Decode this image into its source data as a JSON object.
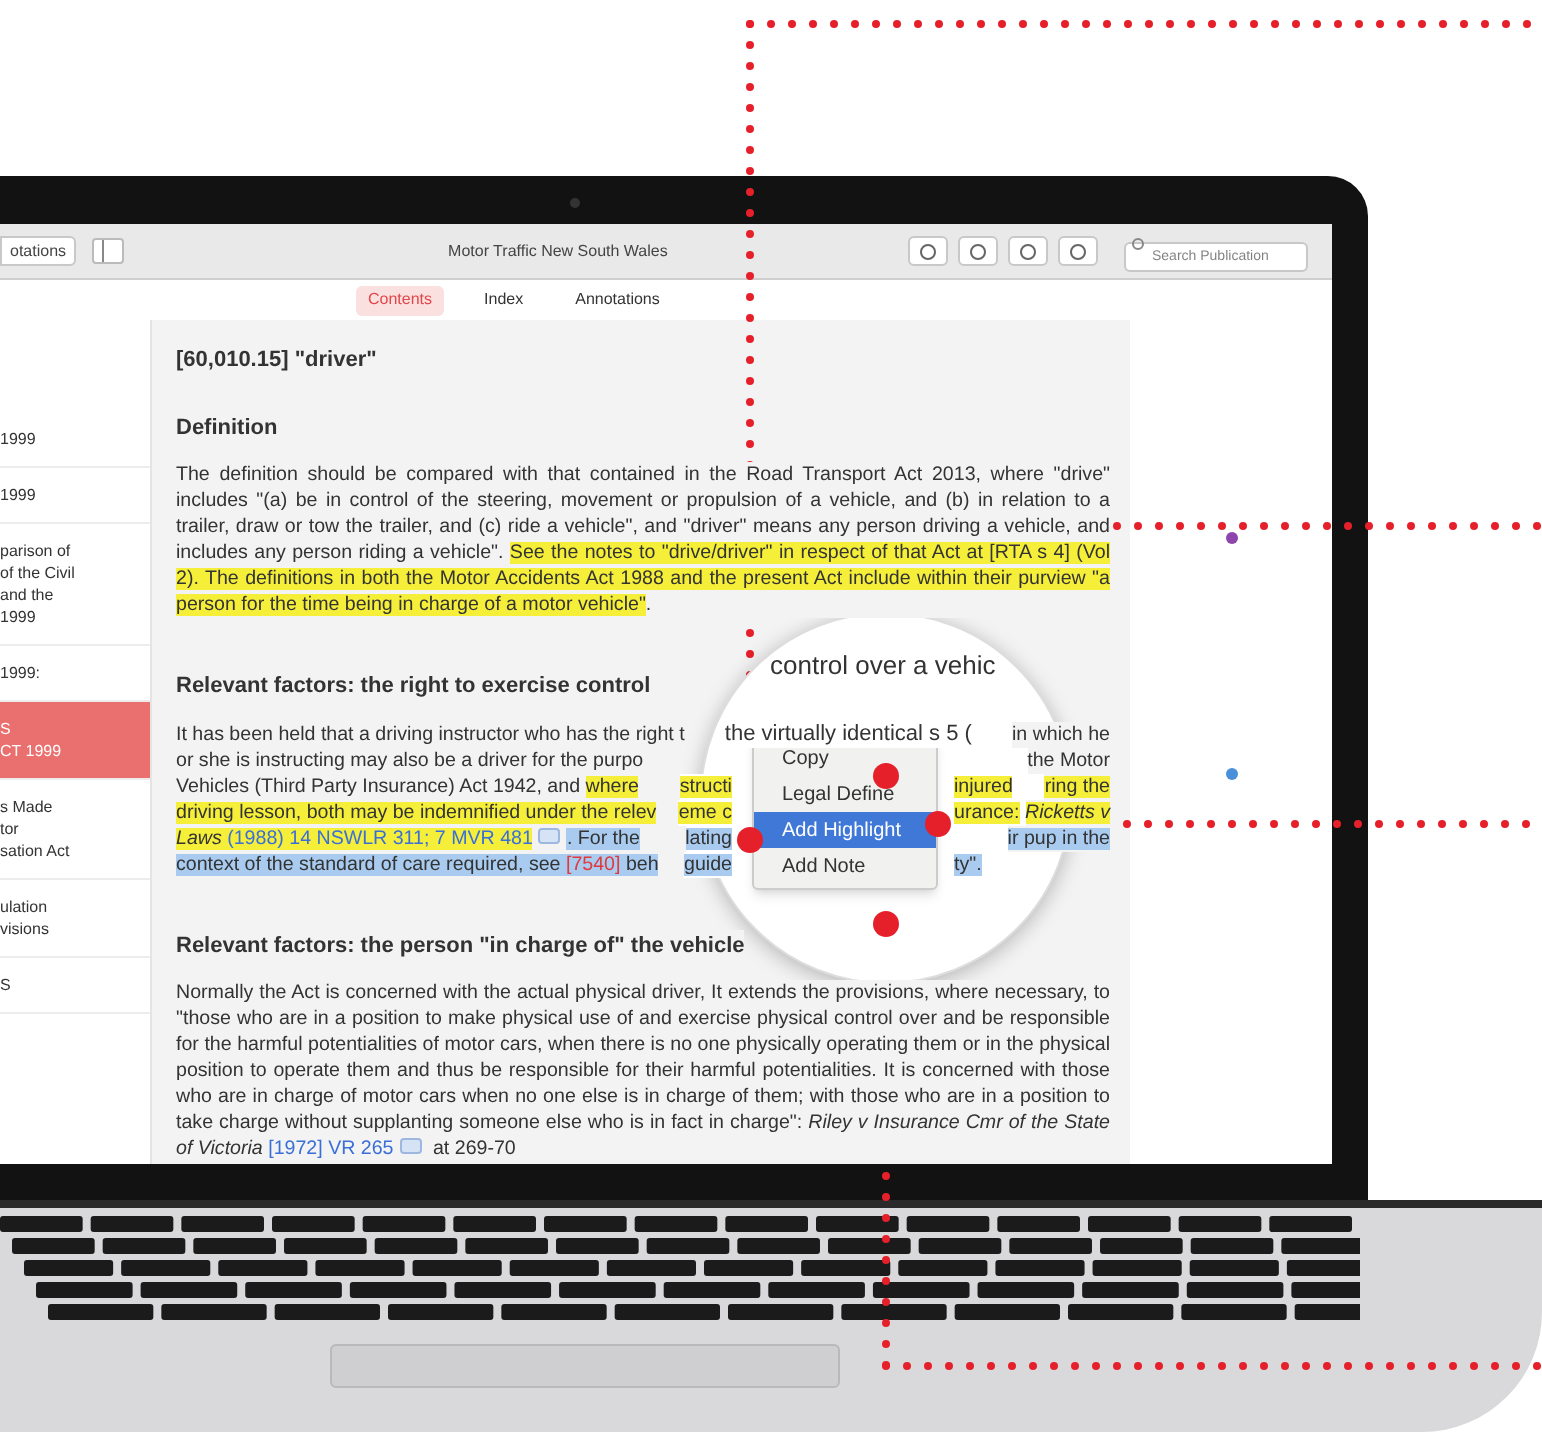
{
  "toolbar": {
    "annotations_button": "otations",
    "title": "Motor Traffic New South Wales",
    "search": {
      "placeholder": "Search Publication"
    }
  },
  "tabs": [
    {
      "label": "Contents",
      "selected": true
    },
    {
      "label": "Index",
      "selected": false
    },
    {
      "label": "Annotations",
      "selected": false
    }
  ],
  "sidebar": {
    "items": [
      {
        "lines": [
          "1999"
        ],
        "selected": false
      },
      {
        "lines": [
          "1999"
        ],
        "selected": false
      },
      {
        "lines": [
          "parison of",
          "of the Civil",
          "and the",
          "1999"
        ],
        "selected": false
      },
      {
        "lines": [
          "1999:"
        ],
        "selected": false
      },
      {
        "lines": [
          "S",
          "CT 1999"
        ],
        "selected": true
      },
      {
        "lines": [
          "s Made",
          "tor",
          "sation Act"
        ],
        "selected": false
      },
      {
        "lines": [
          "ulation",
          "visions"
        ],
        "selected": false
      },
      {
        "lines": [
          "S"
        ],
        "selected": false
      }
    ]
  },
  "document": {
    "title": "[60,010.15] \"driver\"",
    "sections": [
      {
        "heading": "Definition",
        "kind": "flow",
        "segments": [
          {
            "kind": "plain",
            "text": "The definition should be compared with that contained in the Road Transport Act 2013, where \"drive\" includes \"(a) be in control of the steering, movement or propulsion of a vehicle, and (b) in relation to a trailer, draw or tow the trailer, and (c) ride a vehicle\", and \"driver\" means any person driving a vehicle, and includes any person riding a vehicle\". "
          },
          {
            "kind": "highlight",
            "text": "See the notes to \"drive/driver\" in respect of that Act at [RTA s 4] (Vol 2). The definitions in both the Motor Accidents Act 1988 and the present Act include within their purview \"a person for the time being in charge of a motor vehicle\""
          },
          {
            "kind": "plain",
            "text": "."
          }
        ]
      },
      {
        "heading": "Relevant factors: the right to exercise control",
        "kind": "lens_rows",
        "rows": [
          {
            "left": [
              {
                "kind": "plain",
                "text": "It has been held that a driving instructor who has the right t"
              }
            ],
            "lens": [
              {
                "kind": "plain",
                "text": "the virtually identical s 5 ("
              }
            ],
            "right": [
              {
                "kind": "plain",
                "text": "in which he"
              }
            ]
          },
          {
            "left": [
              {
                "kind": "plain",
                "text": "or she is instructing may also be a driver for the purpo"
              }
            ],
            "right": [
              {
                "kind": "plain",
                "text": "the Motor"
              }
            ]
          },
          {
            "left": [
              {
                "kind": "plain",
                "text": "Vehicles (Third Party Insurance) Act 1942, and "
              },
              {
                "kind": "highlight",
                "text": "where"
              }
            ],
            "lens_left": [
              {
                "kind": "highlight",
                "text": "structi"
              }
            ],
            "lens_right": [
              {
                "kind": "highlight",
                "text": "injured"
              }
            ],
            "right": [
              {
                "kind": "highlight",
                "text": "ring the"
              }
            ]
          },
          {
            "left": [
              {
                "kind": "highlight",
                "text": "driving lesson, both may be indemnified under the relev"
              }
            ],
            "lens_left": [
              {
                "kind": "highlight",
                "text": "eme c"
              }
            ],
            "lens_right": [
              {
                "kind": "highlight",
                "text": "urance:"
              }
            ],
            "right": [
              {
                "kind": "highlight_italic",
                "text": "Ricketts v"
              }
            ]
          },
          {
            "left": [
              {
                "kind": "highlight_italic",
                "text": "Laws "
              },
              {
                "kind": "highlight_link",
                "text": "(1988) 14 NSWLR 311; 7 MVR 481"
              },
              {
                "kind": "link_icon"
              },
              {
                "kind": "selected",
                "text": ". For the"
              }
            ],
            "lens_left": [
              {
                "kind": "selected",
                "text": "lating"
              }
            ],
            "right": [
              {
                "kind": "selected",
                "text": "ir pup in the"
              }
            ]
          },
          {
            "left": [
              {
                "kind": "selected",
                "text": "context of the standard of care required, see "
              },
              {
                "kind": "selected_ref",
                "text": "[7540]"
              },
              {
                "kind": "selected",
                "text": " beh"
              }
            ],
            "lens_left": [
              {
                "kind": "selected",
                "text": "guide"
              }
            ],
            "lens_right": [
              {
                "kind": "selected",
                "text": "ty\"."
              }
            ]
          }
        ]
      },
      {
        "heading": "Relevant factors: the person \"in charge of\" the vehicle",
        "kind": "flow",
        "segments": [
          {
            "kind": "plain",
            "text": "Normally the Act is concerned with the actual physical driver, It extends the provisions, where necessary, to \"those who are in a position to make physical use of and exercise physical control over and be responsible for the harmful potentialities of motor cars, when there is no one physically operating them or in the physical position to operate them and thus be responsible for their harmful potentialities. It is concerned with those who are in charge of motor cars when no one else is in charge of them; with those who are in a position to take charge without supplanting someone else who is in fact in charge\": "
          },
          {
            "kind": "italic",
            "text": "Riley v Insurance Cmr of the State of Victoria "
          },
          {
            "kind": "link",
            "text": "[1972] VR 265"
          },
          {
            "kind": "link_icon"
          },
          {
            "kind": "plain",
            "text": " at 269-70"
          }
        ]
      }
    ]
  },
  "markers": [
    {
      "color": "#8e44ad"
    },
    {
      "color": "#4a90d9"
    }
  ],
  "magnifier": {
    "top_text": "control over a vehic",
    "menu": [
      {
        "label": "Copy",
        "selected": false
      },
      {
        "label": "Legal Define",
        "selected": false
      },
      {
        "label": "Add Highlight",
        "selected": true
      },
      {
        "label": "Add Note",
        "selected": false
      }
    ]
  }
}
